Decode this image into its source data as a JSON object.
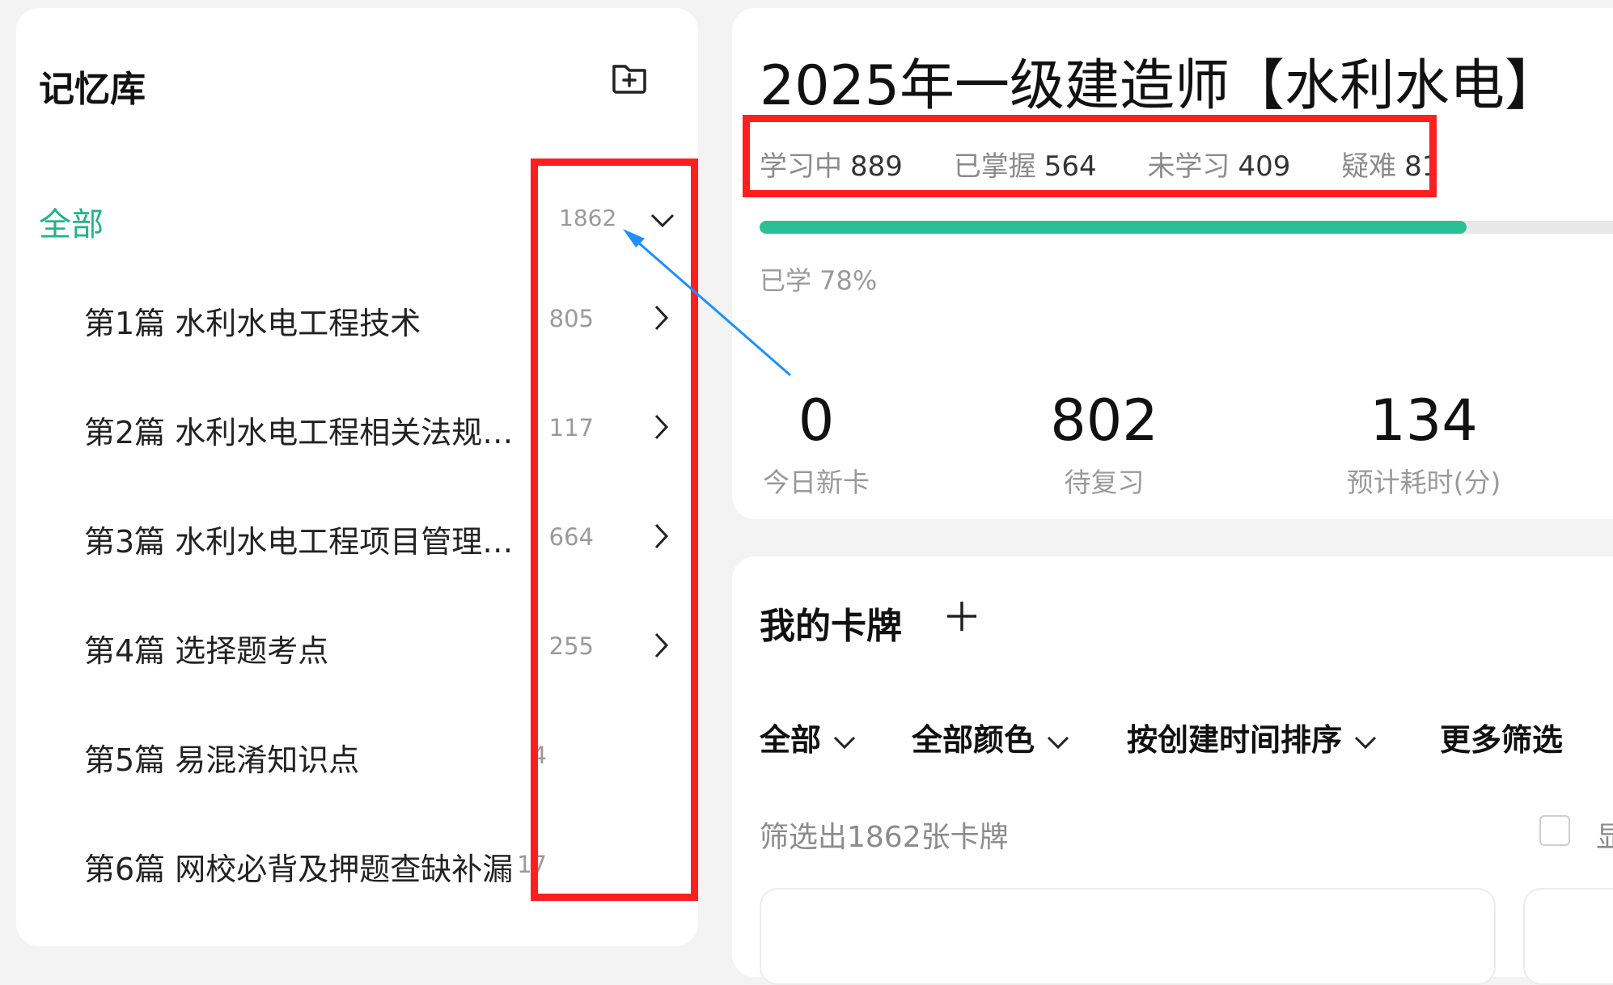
{
  "sidebar": {
    "title": "记忆库",
    "all": {
      "label": "全部",
      "count": "1862"
    },
    "items": [
      {
        "label": "第1篇 水利水电工程技术",
        "count": "805",
        "has_chevron": true
      },
      {
        "label": "第2篇 水利水电工程相关法规…",
        "count": "117",
        "has_chevron": true
      },
      {
        "label": "第3篇 水利水电工程项目管理…",
        "count": "664",
        "has_chevron": true
      },
      {
        "label": "第4篇 选择题考点",
        "count": "255",
        "has_chevron": true
      },
      {
        "label": "第5篇 易混淆知识点",
        "count": "4",
        "has_chevron": false
      },
      {
        "label": "第6篇 网校必背及押题查缺补漏",
        "count": "17",
        "has_chevron": false
      }
    ],
    "icons": {
      "add": "folder-plus-icon"
    }
  },
  "deck": {
    "title": "2025年一级建造师【水利水电】",
    "stats": [
      {
        "label": "学习中",
        "value": "889"
      },
      {
        "label": "已掌握",
        "value": "564"
      },
      {
        "label": "未学习",
        "value": "409"
      },
      {
        "label": "疑难",
        "value": "81"
      }
    ],
    "progress": 0.78,
    "learned_text": "已学 78%",
    "today_new": {
      "value": "0",
      "label": "今日新卡"
    },
    "to_review": {
      "value": "802",
      "label": "待复习"
    },
    "est_time": {
      "value": "134",
      "label": "预计耗时(分)"
    }
  },
  "my_cards": {
    "title": "我的卡牌",
    "filters": [
      "全部",
      "全部颜色",
      "按创建时间排序",
      "更多筛选"
    ],
    "filtered_text": "筛选出1862张卡牌",
    "checkbox_label": "显"
  },
  "colors": {
    "accent": "#1fb38a",
    "progress": "#2bbf96",
    "annotation_red": "#ff1f1f",
    "annotation_arrow": "#1e90ff"
  }
}
